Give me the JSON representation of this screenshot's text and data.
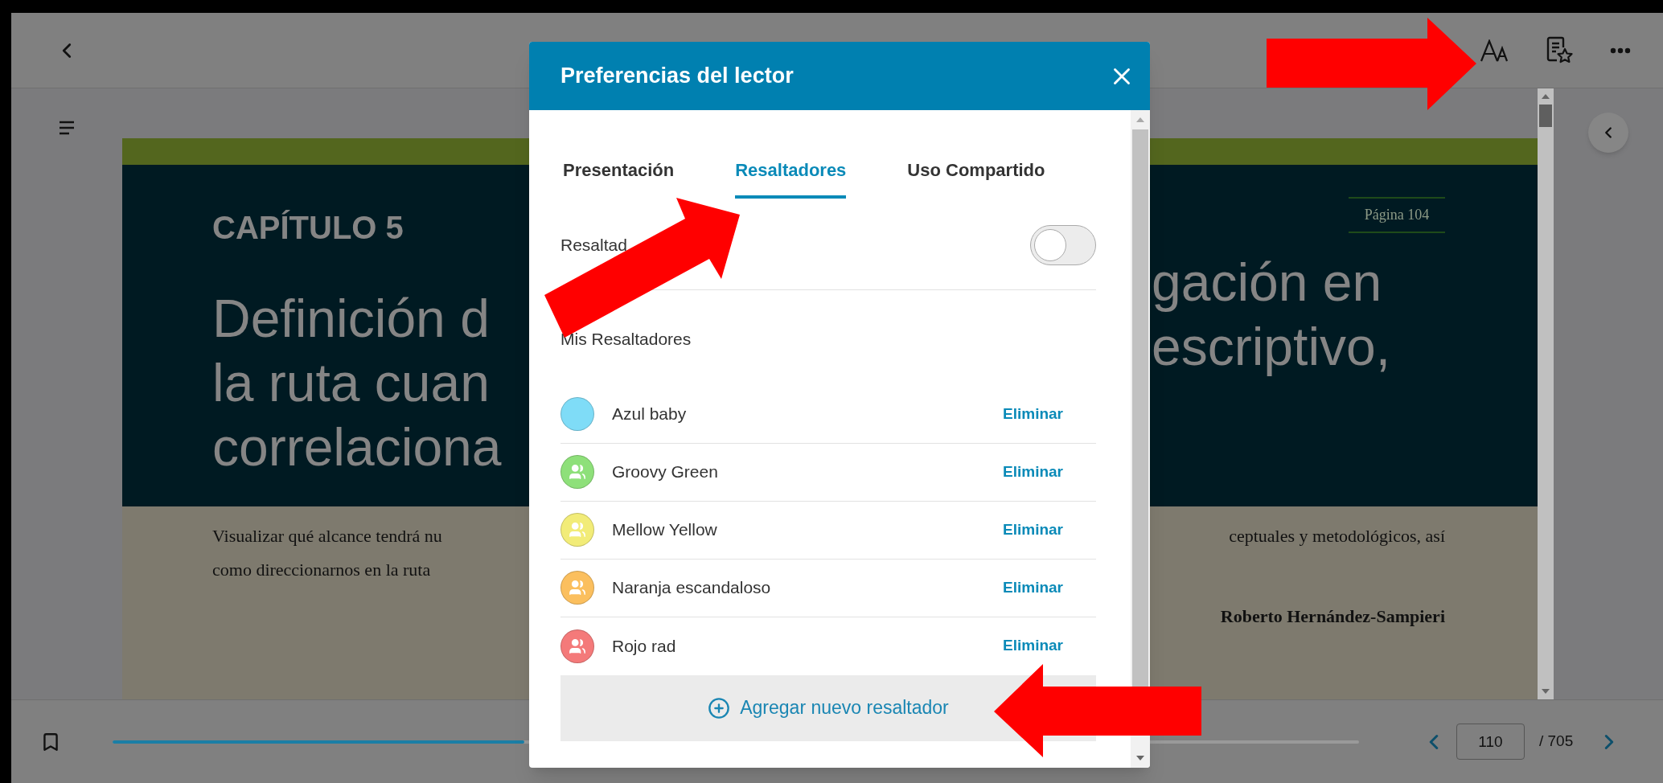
{
  "page": {
    "page_label": "Página 104",
    "chapter": "CAPÍTULO 5",
    "title_left": [
      "Definición d",
      "la ruta cuan",
      "correlaciona"
    ],
    "title_right": [
      "gación en",
      "escriptivo,"
    ],
    "body_left": [
      "Visualizar qué alcance tendrá nu",
      "como direccionarnos en la ruta"
    ],
    "body_right": [
      "ceptuales y metodológicos, así"
    ],
    "author": "Roberto Hernández-Sampieri"
  },
  "dialog": {
    "title": "Preferencias del lector",
    "tabs": [
      {
        "label": "Presentación",
        "selected": false
      },
      {
        "label": "Resaltadores",
        "selected": true
      },
      {
        "label": "Uso Compartido",
        "selected": false
      }
    ],
    "toggle": {
      "label": "Resaltad",
      "on": false
    },
    "section_title": "Mis Resaltadores",
    "highlighters": [
      {
        "name": "Azul baby",
        "color": "#7fdcf7",
        "shared": false,
        "action": "Eliminar"
      },
      {
        "name": "Groovy Green",
        "color": "#8ee07a",
        "shared": true,
        "action": "Eliminar"
      },
      {
        "name": "Mellow Yellow",
        "color": "#f2ec78",
        "shared": true,
        "action": "Eliminar"
      },
      {
        "name": "Naranja escandaloso",
        "color": "#fbbf5e",
        "shared": true,
        "action": "Eliminar"
      },
      {
        "name": "Rojo rad",
        "color": "#f47a7a",
        "shared": true,
        "action": "Eliminar"
      }
    ],
    "add_button": "Agregar nuevo resaltador"
  },
  "bottom_bar": {
    "progress": {
      "level": 0.33
    },
    "page_input": "110",
    "page_total": "/ 705"
  }
}
